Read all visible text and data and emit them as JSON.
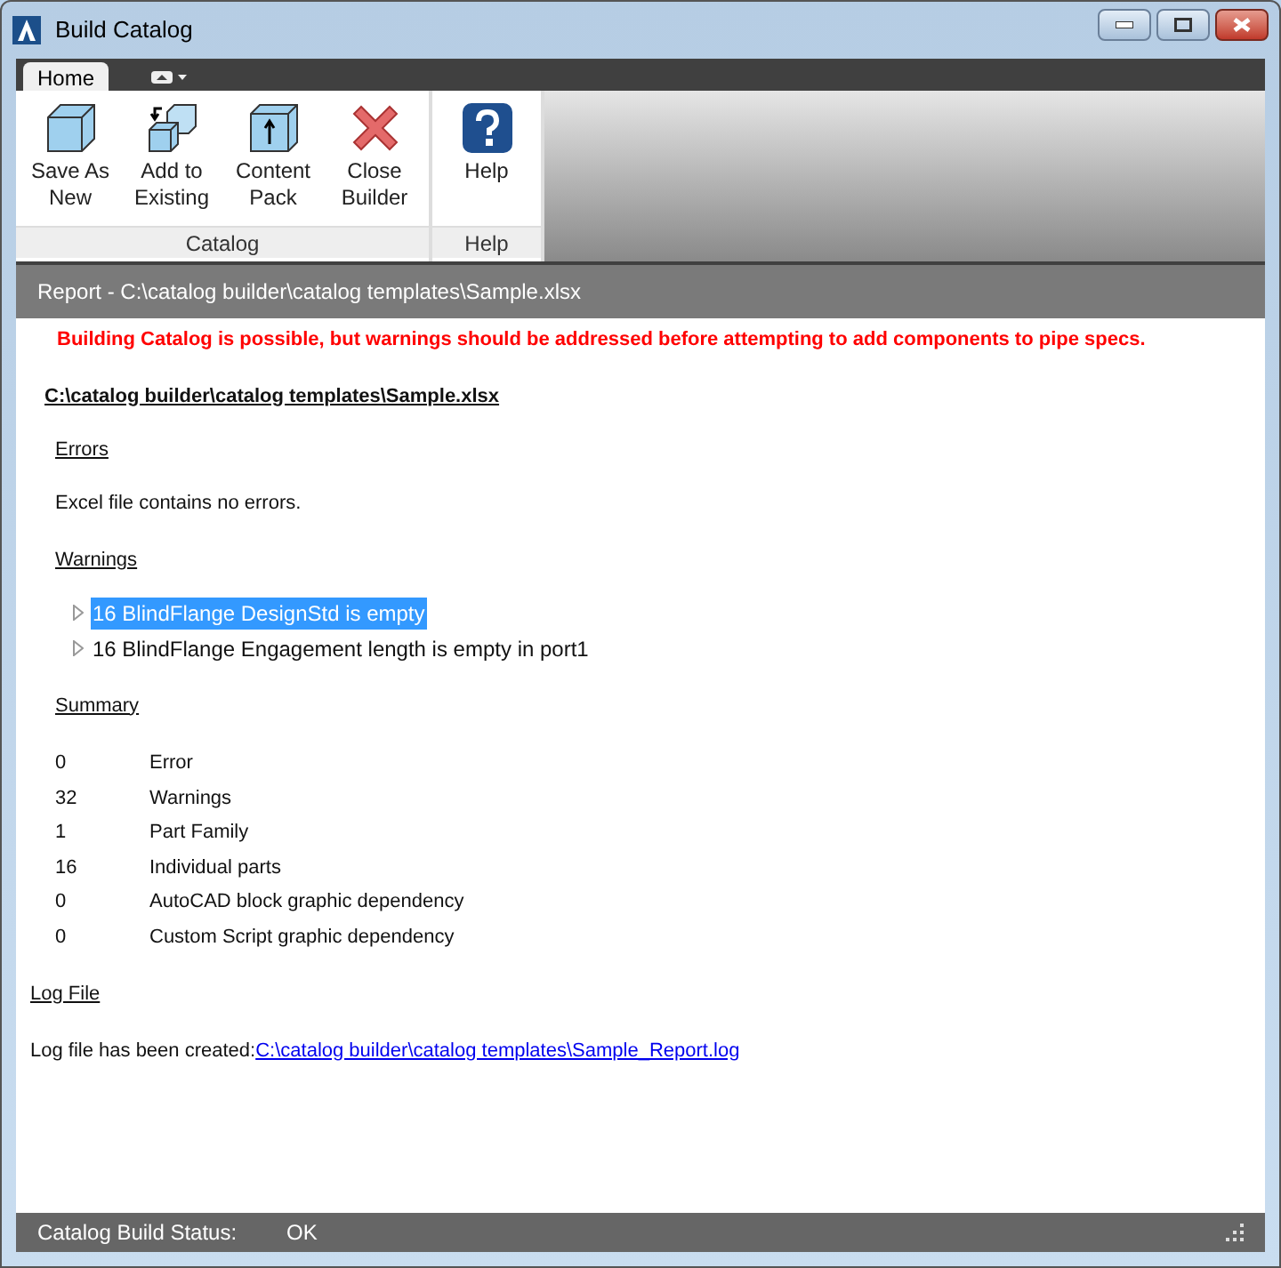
{
  "window": {
    "title": "Build Catalog"
  },
  "tabs": [
    {
      "label": "Home",
      "selected": true
    }
  ],
  "ribbon_groups": [
    {
      "label": "Catalog",
      "buttons": [
        {
          "kind": "cube",
          "label": "Save As New"
        },
        {
          "kind": "add",
          "label": "Add to Existing"
        },
        {
          "kind": "pack",
          "label": "Content Pack"
        },
        {
          "kind": "close",
          "label": "Close Builder"
        }
      ]
    },
    {
      "label": "Help",
      "buttons": [
        {
          "kind": "help",
          "label": "Help"
        }
      ]
    }
  ],
  "report": {
    "header": "Report - C:\\catalog builder\\catalog templates\\Sample.xlsx",
    "banner": "Building Catalog is possible, but warnings should be addressed before attempting to add components to pipe specs.",
    "file": "C:\\catalog builder\\catalog templates\\Sample.xlsx",
    "errors_heading": "Errors",
    "errors_text": "Excel file contains no errors.",
    "warnings_heading": "Warnings",
    "warnings": [
      {
        "text": "16 BlindFlange DesignStd is empty",
        "selected": true
      },
      {
        "text": "16 BlindFlange Engagement length is empty in port1",
        "selected": false
      }
    ],
    "summary_heading": "Summary",
    "summary": [
      {
        "count": "0",
        "label": "Error"
      },
      {
        "count": "32",
        "label": "Warnings"
      },
      {
        "count": "1",
        "label": "Part Family"
      },
      {
        "count": "16",
        "label": "Individual parts"
      },
      {
        "count": "0",
        "label": "AutoCAD block graphic dependency"
      },
      {
        "count": "0",
        "label": "Custom Script graphic dependency"
      }
    ],
    "log_heading": "Log File",
    "log_text": "Log file has been created:",
    "log_link": "C:\\catalog builder\\catalog templates\\Sample_Report.log"
  },
  "status_bar": {
    "label": "Catalog Build Status:",
    "value": "OK"
  }
}
